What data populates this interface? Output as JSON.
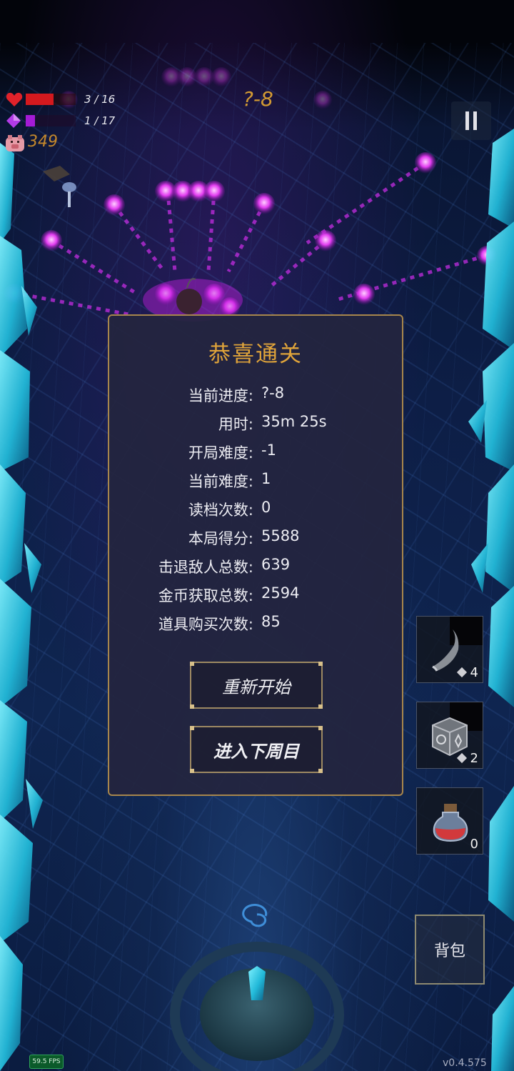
{
  "hud": {
    "hp_text": "3 / 16",
    "hp_fraction": 0.55,
    "mp_text": "1 / 17",
    "mp_fraction": 0.18,
    "gold": "349",
    "level": "?-8",
    "pause_icon": "pause-icon"
  },
  "dialog": {
    "title": "恭喜通关",
    "stats": [
      {
        "label": "当前进度:",
        "value": "?-8"
      },
      {
        "label": "用时:",
        "value": "35m 25s"
      },
      {
        "label": "开局难度:",
        "value": "-1"
      },
      {
        "label": "当前难度:",
        "value": "1"
      },
      {
        "label": "读档次数:",
        "value": "0"
      },
      {
        "label": "本局得分:",
        "value": "5588"
      },
      {
        "label": "击退敌人总数:",
        "value": "639"
      },
      {
        "label": "金币获取总数:",
        "value": "2594"
      },
      {
        "label": "道具购买次数:",
        "value": "85"
      }
    ],
    "restart_label": "重新开始",
    "next_cycle_label": "进入下周目"
  },
  "items": [
    {
      "icon": "horn-icon",
      "count": "4"
    },
    {
      "icon": "rune-cube-icon",
      "count": "2"
    },
    {
      "icon": "potion-icon",
      "count": "0"
    }
  ],
  "bag_label": "背包",
  "fps": "59.5 FPS",
  "version": "v0.4.575",
  "colors": {
    "accent_gold": "#e0a43a",
    "hp": "#d4191e",
    "mp": "#a41bd6",
    "crystal": "#29c8e0"
  }
}
